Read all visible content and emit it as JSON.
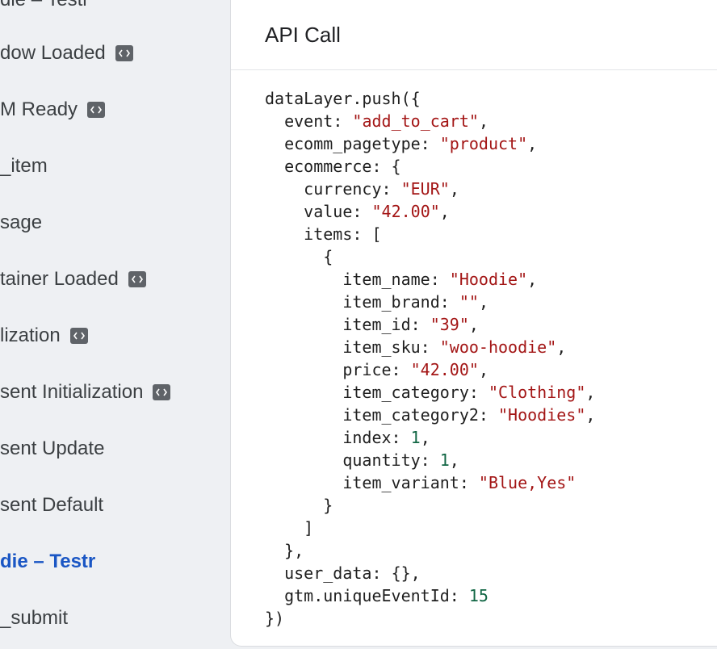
{
  "sidebar": {
    "items": [
      {
        "label": "die – Testr",
        "badge": false
      },
      {
        "label": "dow Loaded",
        "badge": true
      },
      {
        "label": "M Ready",
        "badge": true
      },
      {
        "label": "_item",
        "badge": false
      },
      {
        "label": "sage",
        "badge": false
      },
      {
        "label": "tainer Loaded",
        "badge": true
      },
      {
        "label": "lization",
        "badge": true
      },
      {
        "label": "sent Initialization",
        "badge": true
      },
      {
        "label": "sent Update",
        "badge": false
      },
      {
        "label": "sent Default",
        "badge": false
      },
      {
        "label": "die – Testr",
        "badge": false,
        "active": true
      },
      {
        "label": "_submit",
        "badge": false
      }
    ],
    "badge_icon": "code-icon"
  },
  "panel": {
    "title": "API Call"
  },
  "code": {
    "fn": "dataLayer.push({",
    "event_key": "event",
    "event_val": "\"add_to_cart\"",
    "pagetype_key": "ecomm_pagetype",
    "pagetype_val": "\"product\"",
    "ecommerce_key": "ecommerce",
    "currency_key": "currency",
    "currency_val": "\"EUR\"",
    "value_key": "value",
    "value_val": "\"42.00\"",
    "items_key": "items",
    "item_name_key": "item_name",
    "item_name_val": "\"Hoodie\"",
    "item_brand_key": "item_brand",
    "item_brand_val": "\"\"",
    "item_id_key": "item_id",
    "item_id_val": "\"39\"",
    "item_sku_key": "item_sku",
    "item_sku_val": "\"woo-hoodie\"",
    "price_key": "price",
    "price_val": "\"42.00\"",
    "item_category_key": "item_category",
    "item_category_val": "\"Clothing\"",
    "item_category2_key": "item_category2",
    "item_category2_val": "\"Hoodies\"",
    "index_key": "index",
    "index_val": "1",
    "quantity_key": "quantity",
    "quantity_val": "1",
    "item_variant_key": "item_variant",
    "item_variant_val": "\"Blue,Yes\"",
    "user_data_key": "user_data",
    "user_data_val": "{}",
    "unique_key": "gtm.uniqueEventId",
    "unique_val": "15",
    "close": "})"
  },
  "colors": {
    "string": "#a31515",
    "number": "#116644",
    "active": "#1a56c4"
  }
}
